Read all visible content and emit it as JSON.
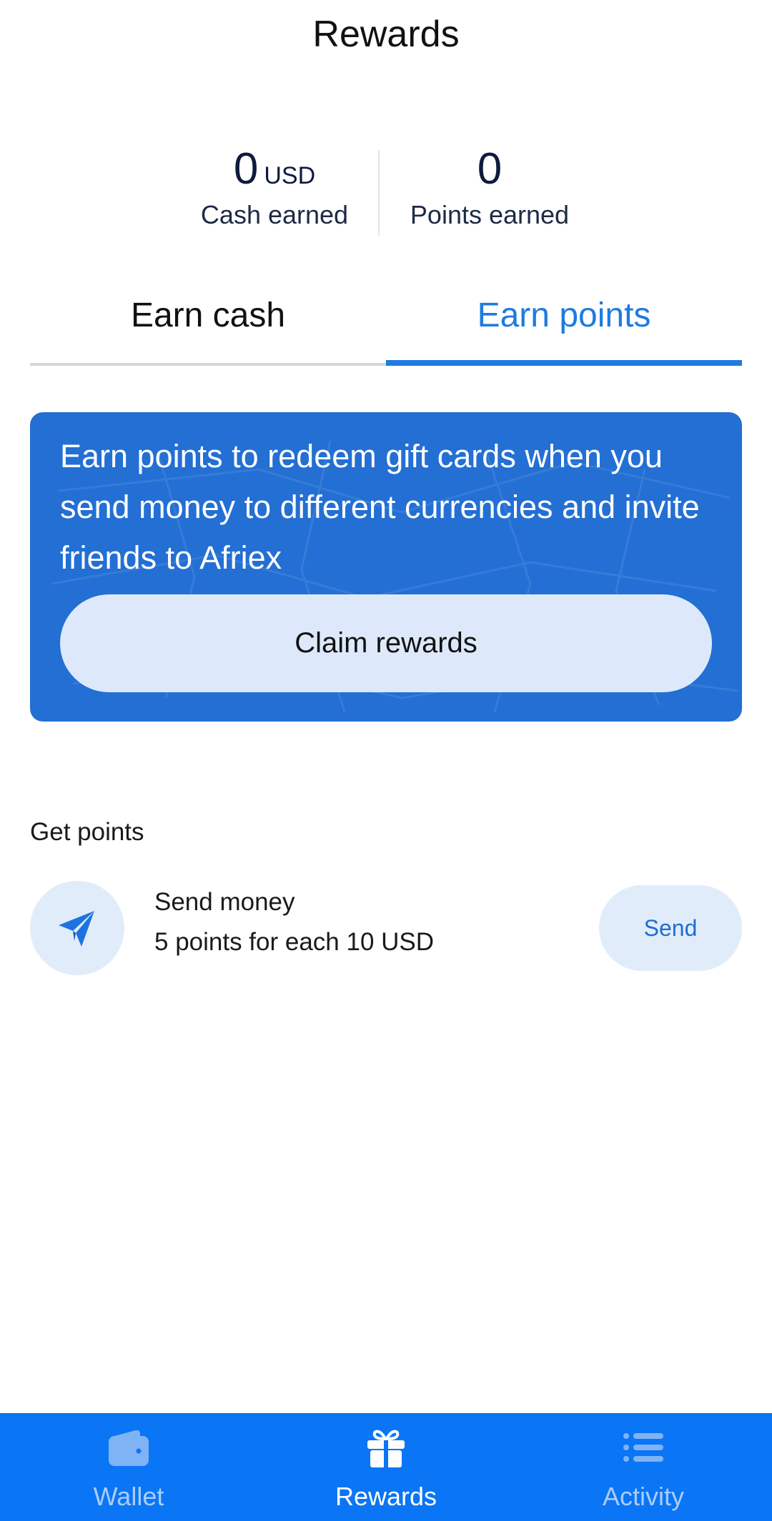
{
  "header": {
    "title": "Rewards"
  },
  "stats": {
    "cash": {
      "value": "0",
      "unit": "USD",
      "label": "Cash earned"
    },
    "points": {
      "value": "0",
      "label": "Points earned"
    }
  },
  "tabs": [
    {
      "label": "Earn cash",
      "active": false
    },
    {
      "label": "Earn points",
      "active": true
    }
  ],
  "banner": {
    "text": "Earn points to redeem gift cards when you send money to different currencies and invite friends to Afriex",
    "button_label": "Claim rewards"
  },
  "get_points": {
    "section_title": "Get points",
    "items": [
      {
        "icon": "paper-plane-icon",
        "title": "Send money",
        "subtitle": "5 points for each 10 USD",
        "action_label": "Send"
      }
    ]
  },
  "bottom_nav": {
    "items": [
      {
        "label": "Wallet",
        "icon": "wallet-icon",
        "active": false
      },
      {
        "label": "Rewards",
        "icon": "gift-icon",
        "active": true
      },
      {
        "label": "Activity",
        "icon": "list-icon",
        "active": false
      }
    ]
  },
  "colors": {
    "accent": "#1e7be0",
    "banner": "#236fd4",
    "nav_background": "#0a75f5",
    "light_blue": "#e1ecfb"
  }
}
